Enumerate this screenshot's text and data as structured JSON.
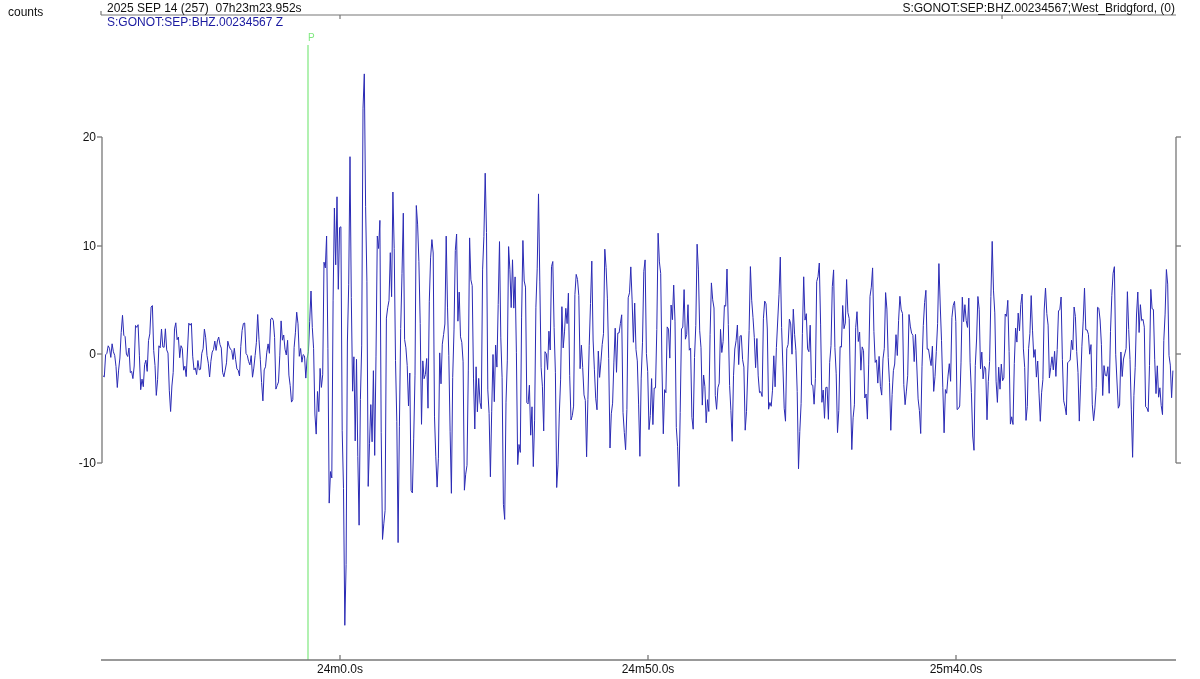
{
  "y_axis": {
    "label": "counts",
    "ticks": [
      "20",
      "10",
      "0",
      "-10"
    ]
  },
  "header": {
    "start_time": "2025 SEP 14 (257)  07h23m23.952s",
    "channel": "S:GONOT:SEP:BHZ.00234567;West_Bridgford, (0)"
  },
  "trace": {
    "label": "S:GONOT:SEP:BHZ.00234567 Z"
  },
  "pick": {
    "label": "P"
  },
  "x_axis": {
    "ticks": [
      "24m0.0s",
      "24m50.0s",
      "25m40.0s"
    ]
  }
}
